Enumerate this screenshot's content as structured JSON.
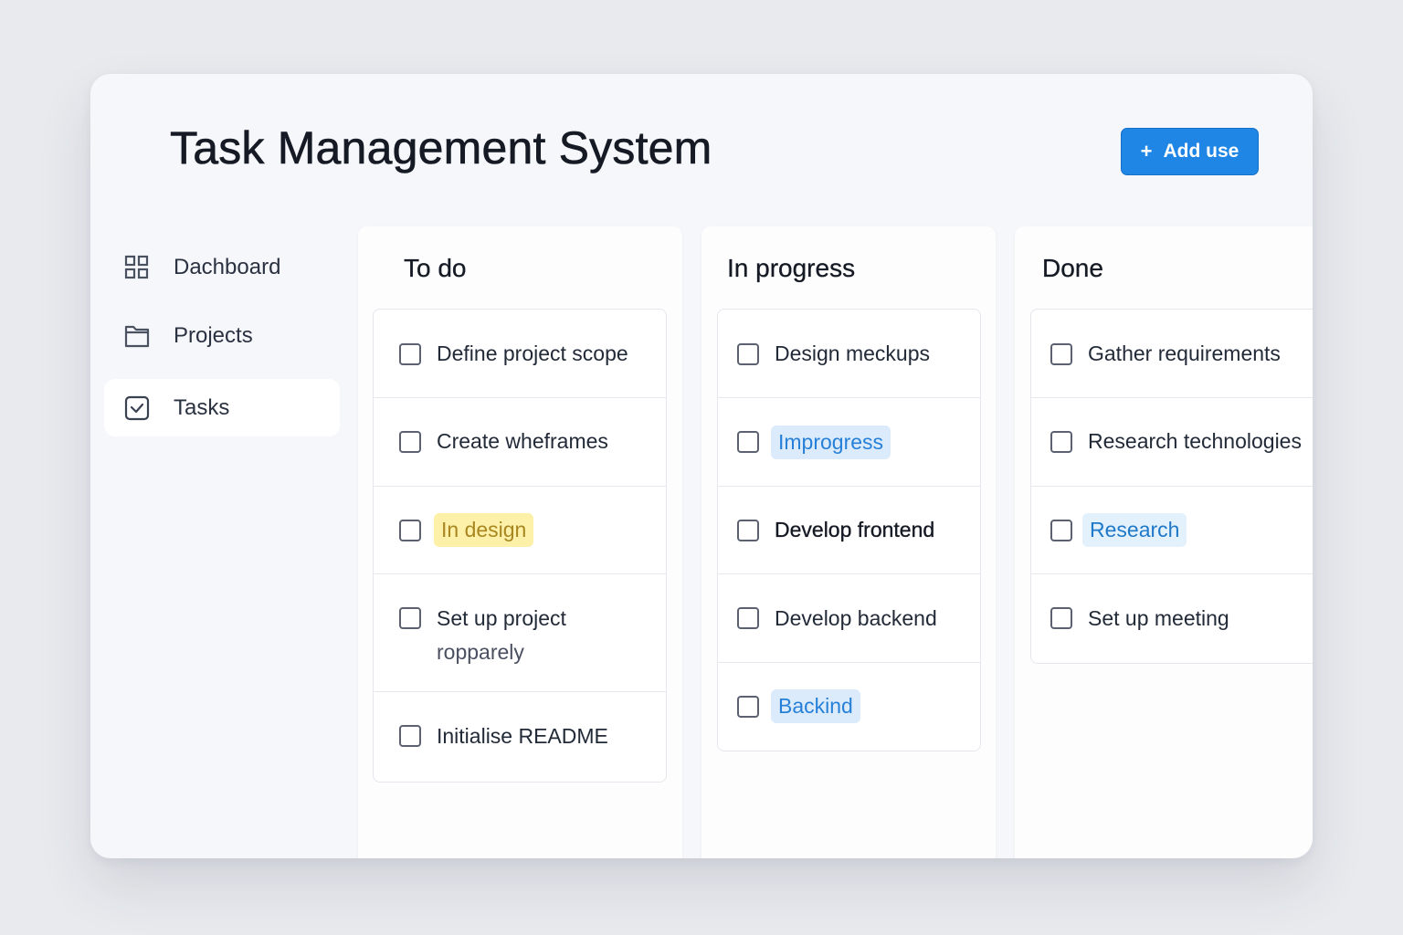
{
  "title": "Task Management System",
  "add_button": {
    "icon": "+",
    "label": "Add use"
  },
  "sidebar": {
    "items": [
      {
        "label": "Dachboard",
        "icon": "grid-icon"
      },
      {
        "label": "Projects",
        "icon": "folder-icon"
      },
      {
        "label": "Tasks",
        "icon": "checkbox-icon",
        "active": true
      }
    ]
  },
  "columns": [
    {
      "title": "To do",
      "tasks": [
        {
          "text": "Define project scope"
        },
        {
          "text": "Create wheframes"
        },
        {
          "text": "In design",
          "tag": "yellow"
        },
        {
          "text_line1": "Set up project",
          "text_line2": "ropparely"
        },
        {
          "text": "Initialise README"
        }
      ]
    },
    {
      "title": "In progress",
      "tasks": [
        {
          "text": "Design meckups"
        },
        {
          "text": "Improgress",
          "tag": "blue"
        },
        {
          "text": "Develop frontend"
        },
        {
          "text": "Develop backend"
        },
        {
          "text": "Backind",
          "tag": "blue"
        }
      ]
    },
    {
      "title": "Done",
      "tasks": [
        {
          "text": "Gather requirements"
        },
        {
          "text": "Research technologies"
        },
        {
          "text": "Research",
          "tag": "lightblue"
        },
        {
          "text": "Set up meeting"
        }
      ]
    }
  ],
  "colors": {
    "accent": "#1f86e6",
    "tag_yellow_bg": "#fdf0a8",
    "tag_blue_bg": "#dcebfb"
  }
}
